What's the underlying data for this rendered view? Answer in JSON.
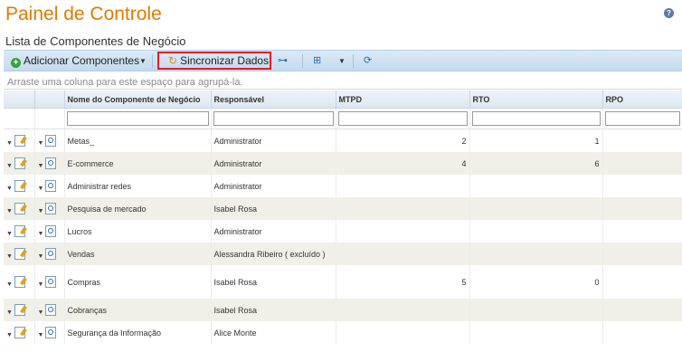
{
  "page": {
    "title": "Painel de Controle",
    "help_icon": "help-icon",
    "help_glyph": "?"
  },
  "section": {
    "title": "Lista de Componentes de Negócio"
  },
  "toolbar": {
    "add_label": "Adicionar Componentes",
    "add_glyph": "+",
    "sync_label": "Sincronizar Dados",
    "sync_glyph": "↻",
    "hierarchy_glyph": "⊶",
    "columns_glyph": "⊞",
    "refresh_glyph": "⟳",
    "caret": "▼"
  },
  "grid": {
    "group_hint": "Arraste uma coluna para este espaço para agrupá-la.",
    "columns": [
      "Nome do Componente de Negócio",
      "Responsável",
      "MTPD",
      "RTO",
      "RPO"
    ],
    "row_caret": "▼",
    "rows": [
      {
        "name": "Metas_",
        "owner": "Administrator",
        "mtpd": "2",
        "rto": "1",
        "rpo": ""
      },
      {
        "name": "E-commerce",
        "owner": "Administrator",
        "mtpd": "4",
        "rto": "6",
        "rpo": ""
      },
      {
        "name": "Administrar redes",
        "owner": "Administrator",
        "mtpd": "",
        "rto": "",
        "rpo": ""
      },
      {
        "name": "Pesquisa de mercado",
        "owner": "Isabel Rosa",
        "mtpd": "",
        "rto": "",
        "rpo": ""
      },
      {
        "name": "Lucros",
        "owner": "Administrator",
        "mtpd": "",
        "rto": "",
        "rpo": ""
      },
      {
        "name": "Vendas",
        "owner": "Alessandra Ribeiro ( excluído )",
        "mtpd": "",
        "rto": "",
        "rpo": ""
      },
      {
        "name": "Compras",
        "owner": "Isabel Rosa",
        "mtpd": "5",
        "rto": "0",
        "rpo": ""
      },
      {
        "name": "Cobranças",
        "owner": "Isabel Rosa",
        "mtpd": "",
        "rto": "",
        "rpo": ""
      },
      {
        "name": "Segurança da Informação",
        "owner": "Alice Monte",
        "mtpd": "",
        "rto": "",
        "rpo": ""
      }
    ]
  }
}
